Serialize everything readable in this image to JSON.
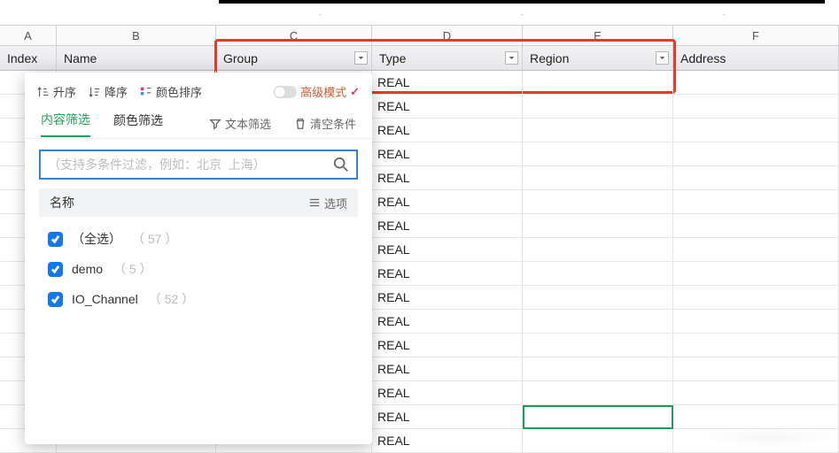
{
  "columns": {
    "letters": [
      "A",
      "B",
      "C",
      "D",
      "E",
      "F"
    ],
    "widths": [
      64,
      180,
      176,
      170,
      170,
      187
    ]
  },
  "fields": {
    "index": "Index",
    "name": "Name",
    "group": "Group",
    "type": "Type",
    "region": "Region",
    "address": "Address"
  },
  "grid": {
    "type_value": "REAL",
    "row_count": 16
  },
  "active_cell": {
    "col": "E",
    "row_index": 14
  },
  "filter": {
    "sort": {
      "asc": "升序",
      "desc": "降序",
      "color_sort": "颜色排序",
      "advanced_mode": "高级模式"
    },
    "tabs": {
      "content": "内容筛选",
      "color": "颜色筛选",
      "text": "文本筛选",
      "clear": "清空条件"
    },
    "search": {
      "placeholder": "（支持多条件过滤，例如：北京  上海）",
      "value": ""
    },
    "list": {
      "header": "名称",
      "options": "选项",
      "items": [
        {
          "label": "（全选）",
          "count": "（ 57 ）"
        },
        {
          "label": "demo",
          "count": "（ 5 ）"
        },
        {
          "label": "IO_Channel",
          "count": "（ 52 ）"
        }
      ]
    }
  },
  "colors": {
    "red_highlight": "#e43b2b",
    "green_active": "#1a9e5a",
    "filter_green": "#1da456",
    "checkbox_blue": "#1378f0",
    "search_border": "#3a7fd6"
  }
}
